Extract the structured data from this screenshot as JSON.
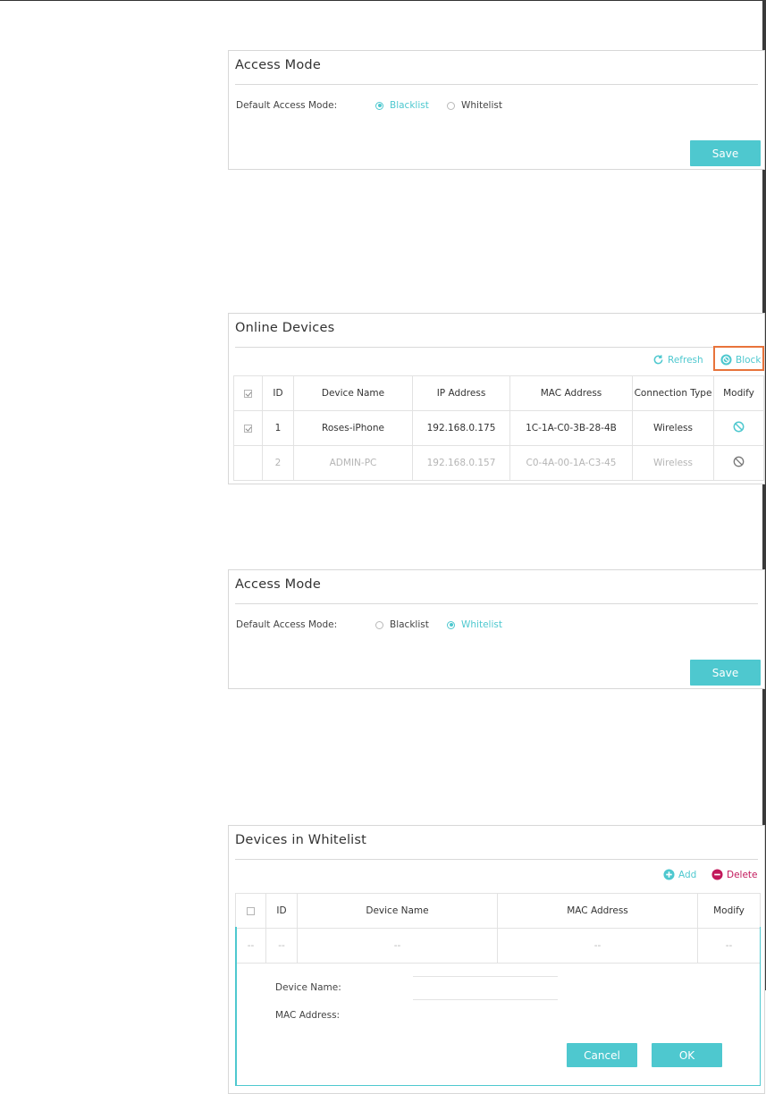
{
  "panel1": {
    "title": "Access Mode",
    "label": "Default Access Mode:",
    "options": [
      "Blacklist",
      "Whitelist"
    ],
    "selected": "Blacklist",
    "save_label": "Save"
  },
  "panel2": {
    "title": "Online Devices",
    "refresh_label": "Refresh",
    "block_label": "Block",
    "columns": [
      "ID",
      "Device Name",
      "IP Address",
      "MAC Address",
      "Connection Type",
      "Modify"
    ],
    "rows": [
      {
        "checked": true,
        "id": "1",
        "name": "Roses-iPhone",
        "ip": "192.168.0.175",
        "mac": "1C-1A-C0-3B-28-4B",
        "type": "Wireless"
      },
      {
        "checked": false,
        "id": "2",
        "name": "ADMIN-PC",
        "ip": "192.168.0.157",
        "mac": "C0-4A-00-1A-C3-45",
        "type": "Wireless"
      }
    ]
  },
  "panel3": {
    "title": "Access Mode",
    "label": "Default Access Mode:",
    "options": [
      "Blacklist",
      "Whitelist"
    ],
    "selected": "Whitelist",
    "save_label": "Save"
  },
  "panel4": {
    "title": "Devices in Whitelist",
    "add_label": "Add",
    "delete_label": "Delete",
    "columns": [
      "ID",
      "Device Name",
      "MAC Address",
      "Modify"
    ],
    "empty_row": [
      "--",
      "--",
      "--",
      "--",
      "--"
    ],
    "form": {
      "device_name_label": "Device Name:",
      "mac_label": "MAC Address:",
      "device_name_value": "",
      "mac_value": "",
      "cancel_label": "Cancel",
      "ok_label": "OK"
    }
  },
  "colors": {
    "accent": "#4ec8cf",
    "highlight": "#e8733b",
    "delete": "#c2185b"
  }
}
